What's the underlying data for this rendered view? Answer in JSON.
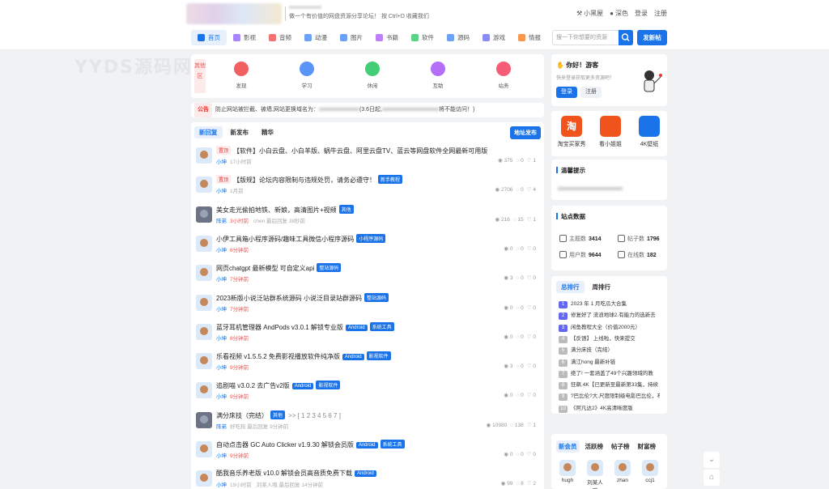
{
  "header": {
    "slogan": "做一个有价值的网盘资源分享论坛！ 按 Ctrl+D 收藏我们",
    "links": [
      "小黑屋",
      "深色",
      "登录",
      "注册"
    ],
    "nav": [
      {
        "label": "首页",
        "icon": "home-icon",
        "color": "#1a73e8"
      },
      {
        "label": "影视",
        "icon": "video-icon",
        "color": "#8b5cf6"
      },
      {
        "label": "音频",
        "icon": "audio-icon",
        "color": "#ef4444"
      },
      {
        "label": "动漫",
        "icon": "anime-icon",
        "color": "#3b82f6"
      },
      {
        "label": "图片",
        "icon": "image-icon",
        "color": "#3b82f6"
      },
      {
        "label": "书籍",
        "icon": "book-icon",
        "color": "#a855f7"
      },
      {
        "label": "软件",
        "icon": "software-icon",
        "color": "#22c55e"
      },
      {
        "label": "源码",
        "icon": "code-icon",
        "color": "#3b82f6"
      },
      {
        "label": "游戏",
        "icon": "game-icon",
        "color": "#6366f1"
      },
      {
        "label": "情报",
        "icon": "news-icon",
        "color": "#f97316"
      }
    ],
    "search_placeholder": "搜一下你想要的资源",
    "post_button": "发新帖"
  },
  "watermark": "YYDS源码网",
  "categories": {
    "other": "其他区",
    "items": [
      {
        "label": "发现",
        "color": "#ef4444"
      },
      {
        "label": "学习",
        "color": "#3b82f6"
      },
      {
        "label": "休闲",
        "color": "#22c55e"
      },
      {
        "label": "互助",
        "color": "#a855f7"
      },
      {
        "label": "站务",
        "color": "#f43f5e"
      }
    ]
  },
  "notice": {
    "label": "公告",
    "text_a": "防止网站被拦截、被墙,网站更换域名为：",
    "text_b": "(3.6日起,",
    "text_c": "将不能访问！)"
  },
  "threads": {
    "tabs": [
      "新回复",
      "新发布",
      "精华"
    ],
    "addr_button": "地址发布",
    "items": [
      {
        "hot": "置顶",
        "title": "【软件】小白云盘、小白羊版、蜗牛云盘、阿里云盘TV、蓝云等网盘软件全网最新可用版",
        "tags": [],
        "user": "小坤",
        "time": "17小时前",
        "last": "",
        "views": "375",
        "replies": "0",
        "likes": "1",
        "dark": false
      },
      {
        "hot": "置顶",
        "title": "【版规】论坛内容限制与违规处罚，请务必遵守！",
        "tags": [
          "新手教程"
        ],
        "user": "小坤",
        "time": "1月前",
        "last": "",
        "views": "2706",
        "replies": "0",
        "likes": "4",
        "dark": false
      },
      {
        "hot": "",
        "title": "美女走光偷拍地铁、新娘，高清图片+视频",
        "tags": [
          "其他"
        ],
        "user": "阵弟",
        "time": "3小时前",
        "last": "chen  最后回复 38秒前",
        "views": "216",
        "replies": "15",
        "likes": "1",
        "dark": true
      },
      {
        "hot": "",
        "title": "小伊工具箱小程序源码/趣味工具微信小程序源码",
        "tags": [
          "小程序源码"
        ],
        "user": "小坤",
        "time": "6分钟前",
        "last": "",
        "views": "0",
        "replies": "0",
        "likes": "0",
        "dark": false
      },
      {
        "hot": "",
        "title": "网页chatgpt 最新模型 可自定义api",
        "tags": [
          "整站源码"
        ],
        "user": "小坤",
        "time": "7分钟前",
        "last": "",
        "views": "3",
        "replies": "0",
        "likes": "0",
        "dark": false
      },
      {
        "hot": "",
        "title": "2023新版小说泛站群系统源码 小说泛目录站群源码",
        "tags": [
          "整站源码"
        ],
        "user": "小坤",
        "time": "7分钟前",
        "last": "",
        "views": "0",
        "replies": "0",
        "likes": "0",
        "dark": false
      },
      {
        "hot": "",
        "title": "蓝牙耳机管理器 AndPods v3.0.1 解锁专业版",
        "tags": [
          "Android",
          "系统工具"
        ],
        "user": "小坤",
        "time": "8分钟前",
        "last": "",
        "views": "0",
        "replies": "0",
        "likes": "0",
        "dark": false
      },
      {
        "hot": "",
        "title": "乐看视频 v1.5.5.2 免费影视播放软件纯净版",
        "tags": [
          "Android",
          "影视软件"
        ],
        "user": "小坤",
        "time": "9分钟前",
        "last": "",
        "views": "3",
        "replies": "0",
        "likes": "0",
        "dark": false
      },
      {
        "hot": "",
        "title": "追剧喵 v3.0.2 去广告v2版",
        "tags": [
          "Android",
          "影视软件"
        ],
        "user": "小坤",
        "time": "9分钟前",
        "last": "",
        "views": "0",
        "replies": "0",
        "likes": "0",
        "dark": false
      },
      {
        "hot": "",
        "title": "满分床技（完结）",
        "tags": [
          "其他"
        ],
        "user": "阵弟",
        "time": "",
        "last": "好吃狗  最后回复 9分钟前",
        "views": "10980",
        "replies": "138",
        "likes": "1",
        "dark": true,
        "pages": ">> [ 1 2 3 4 5 6 7 ]"
      },
      {
        "hot": "",
        "title": "自动点击器 GC Auto Clicker v1.9.30 解锁会员版",
        "tags": [
          "Android",
          "系统工具"
        ],
        "user": "小坤",
        "time": "9分钟前",
        "last": "",
        "views": "0",
        "replies": "0",
        "likes": "0",
        "dark": false
      },
      {
        "hot": "",
        "title": "酷我音乐养老版 v10.0 解锁会员高音质免费下载",
        "tags": [
          "Android"
        ],
        "user": "小坤",
        "time": "19小时前",
        "last": "刘某人哦  最后回复 14分钟前",
        "views": "99",
        "replies": "8",
        "likes": "2",
        "dark": false
      }
    ]
  },
  "sidebar": {
    "greet_title": "你好！游客",
    "greet_sub": "快来登录获取更多资源吧！",
    "login": "登录",
    "register": "注册",
    "apps": [
      {
        "label": "淘宝买家秀",
        "color": "#f0531c",
        "icon": "taobao-icon",
        "glyph": "淘"
      },
      {
        "label": "看小姐姐",
        "color": "#f0531c",
        "icon": "video-app-icon",
        "glyph": ""
      },
      {
        "label": "4K壁纸",
        "color": "#1a73e8",
        "icon": "wallpaper-icon",
        "glyph": ""
      }
    ],
    "tips_title": "温馨提示",
    "stats_title": "站点数据",
    "stats": [
      {
        "label": "主题数",
        "value": "3414"
      },
      {
        "label": "帖子数",
        "value": "1796"
      },
      {
        "label": "用户数",
        "value": "9644"
      },
      {
        "label": "在线数",
        "value": "182"
      }
    ],
    "rank_tabs": [
      "总排行",
      "周排行"
    ],
    "rank": [
      {
        "n": "1",
        "text": "2023 年 1 月吃瓜大合集",
        "color": "#6366f1"
      },
      {
        "n": "2",
        "text": "修复好了 流浪地球2.有能力的选新去",
        "color": "#6366f1"
      },
      {
        "n": "3",
        "text": "闲鱼教程大全（价值2000元）",
        "color": "#6366f1"
      },
      {
        "n": "4",
        "text": "【反馈】 上线啦，快来提交",
        "color": "#bbb"
      },
      {
        "n": "5",
        "text": "满分床技（完结）",
        "color": "#bbb"
      },
      {
        "n": "6",
        "text": "满江hong 最新补链",
        "color": "#bbb"
      },
      {
        "n": "7",
        "text": "绝了! 一套涵盖了49个兴趣领域的教",
        "color": "#bbb"
      },
      {
        "n": "8",
        "text": "狂飙.4K【已更新至最新第33集，持续",
        "color": "#bbb"
      },
      {
        "n": "9",
        "text": "?巴比伦?大.尺度限制级电影巴比伦，布",
        "color": "#bbb"
      },
      {
        "n": "10",
        "text": "《阿凡达2》4K高清晰度版",
        "color": "#bbb"
      }
    ],
    "member_tabs": [
      "新会员",
      "活跃榜",
      "帖子榜",
      "财富榜"
    ],
    "members": [
      "hugh",
      "刘某人哦",
      "zhan",
      "ccj1"
    ]
  }
}
